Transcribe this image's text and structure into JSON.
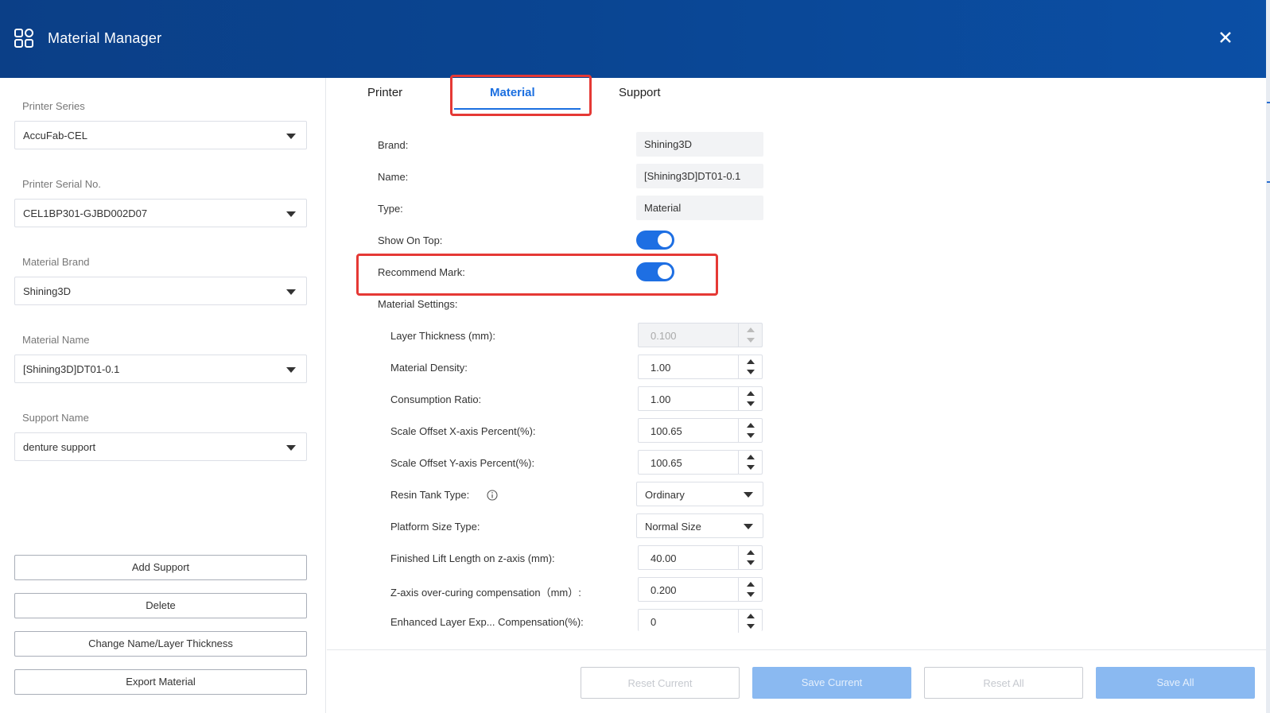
{
  "window": {
    "title": "Material Manager"
  },
  "left": {
    "fields": [
      {
        "label": "Printer Series",
        "value": "AccuFab-CEL"
      },
      {
        "label": "Printer Serial No.",
        "value": "CEL1BP301-GJBD002D07"
      },
      {
        "label": "Material Brand",
        "value": "Shining3D"
      },
      {
        "label": "Material Name",
        "value": "[Shining3D]DT01-0.1"
      },
      {
        "label": "Support Name",
        "value": "denture support"
      }
    ],
    "buttons": {
      "add_support": "Add Support",
      "delete": "Delete",
      "change_name": "Change Name/Layer Thickness",
      "export": "Export Material"
    }
  },
  "tabs": {
    "printer": "Printer",
    "material": "Material",
    "support": "Support",
    "active": "Material"
  },
  "material": {
    "brand_label": "Brand:",
    "brand_value": "Shining3D",
    "name_label": "Name:",
    "name_value": "[Shining3D]DT01-0.1",
    "type_label": "Type:",
    "type_value": "Material",
    "show_on_top_label": "Show On Top:",
    "show_on_top": true,
    "recommend_mark_label": "Recommend Mark:",
    "recommend_mark": true,
    "settings_label": "Material Settings:",
    "layer_thickness_label": "Layer Thickness (mm):",
    "layer_thickness": "0.100",
    "density_label": "Material Density:",
    "density": "1.00",
    "consumption_label": "Consumption Ratio:",
    "consumption": "1.00",
    "scale_x_label": "Scale Offset X-axis Percent(%):",
    "scale_x": "100.65",
    "scale_y_label": "Scale Offset Y-axis Percent(%):",
    "scale_y": "100.65",
    "resin_tank_label": "Resin Tank Type:",
    "resin_tank": "Ordinary",
    "platform_label": "Platform Size Type:",
    "platform": "Normal Size",
    "lift_label": "Finished Lift Length on z-axis (mm):",
    "lift": "40.00",
    "zcomp_label": "Z-axis over-curing compensation（mm）:",
    "zcomp": "0.200",
    "enhanced_label": "Enhanced Layer Exp... Compensation(%):",
    "enhanced": "0"
  },
  "footer": {
    "reset_current": "Reset Current",
    "save_current": "Save Current",
    "reset_all": "Reset All",
    "save_all": "Save All"
  },
  "colors": {
    "accent": "#1b6fe0",
    "highlight": "#e53935",
    "titlebar": "#0b4596"
  }
}
